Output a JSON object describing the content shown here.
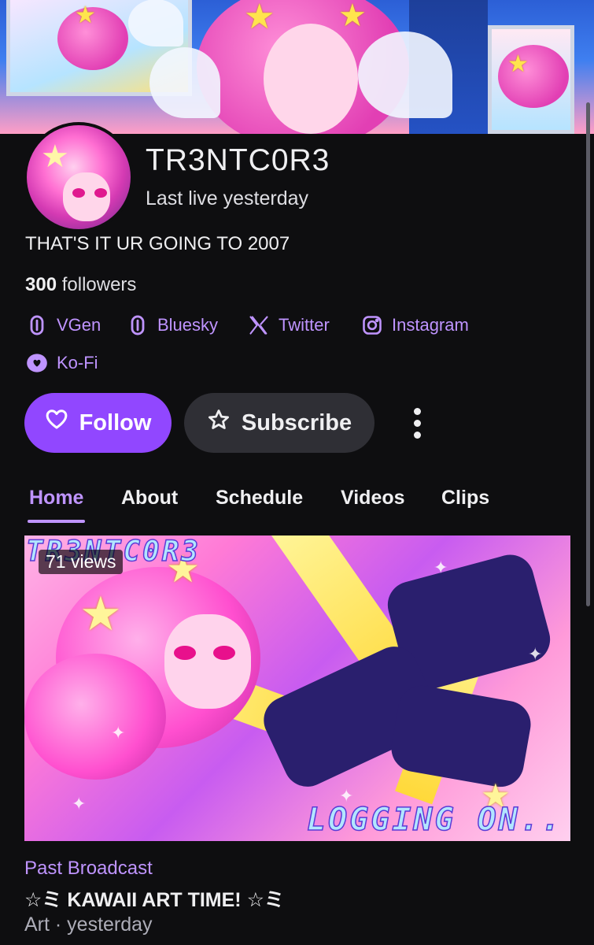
{
  "channel": {
    "name": "TR3NTC0R3",
    "last_live": "Last live yesterday",
    "bio": "THAT'S IT UR GOING TO 2007",
    "followers_count": "300",
    "followers_label": " followers"
  },
  "social_links": [
    {
      "label": "VGen",
      "icon": "link-icon"
    },
    {
      "label": "Bluesky",
      "icon": "link-icon"
    },
    {
      "label": "Twitter",
      "icon": "x-twitter-icon"
    },
    {
      "label": "Instagram",
      "icon": "instagram-icon"
    },
    {
      "label": "Ko-Fi",
      "icon": "kofi-icon"
    }
  ],
  "actions": {
    "follow_label": "Follow",
    "subscribe_label": "Subscribe"
  },
  "tabs": [
    {
      "label": "Home",
      "active": true
    },
    {
      "label": "About",
      "active": false
    },
    {
      "label": "Schedule",
      "active": false
    },
    {
      "label": "Videos",
      "active": false
    },
    {
      "label": "Clips",
      "active": false
    }
  ],
  "video": {
    "views": "71 views",
    "thumbnail_title": "TR3NTC0R3",
    "thumbnail_tag": "LOGGING ON..",
    "type_label": "Past Broadcast",
    "title": "☆ミ KAWAII ART TIME! ☆ミ",
    "meta": "Art · yesterday"
  },
  "colors": {
    "accent": "#9147ff",
    "accent_text": "#bf94ff",
    "background": "#0e0e10",
    "secondary_button": "#2f2f35"
  }
}
